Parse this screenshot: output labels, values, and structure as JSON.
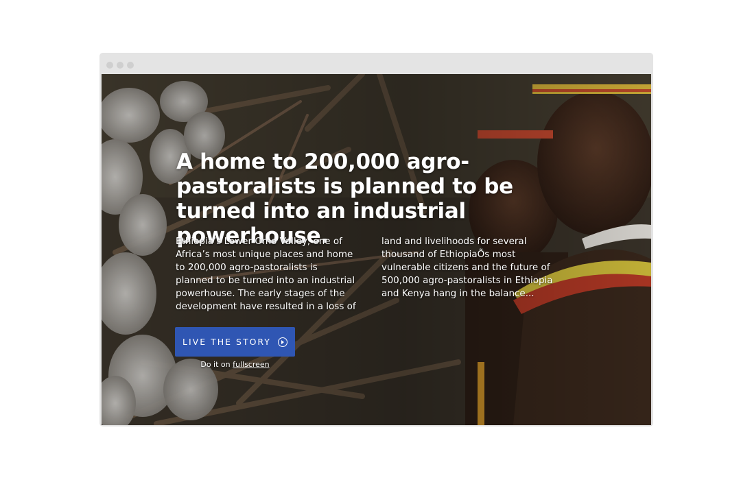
{
  "hero": {
    "headline": "A home to 200,000 agro-pastoralists is planned to be turned into an industrial powerhouse.",
    "body_left": "Ethiopia’s Lower Omo Valley, one of\nAfrica’s most unique places and home\nto 200,000 agro-pastoralists is\nplanned to be turned into an industrial\npowerhouse. The early stages of the\ndevelopment have resulted in a loss of",
    "body_right": "land and livelihoods for several\nthousand of EthiopiaÕs most\nvulnerable citizens and the future of\n500,000 agro-pastoralists in Ethiopia\nand Kenya hang in the balance...",
    "cta_label": "LIVE THE STORY",
    "cta_icon": "play-circle-icon",
    "fullscreen_prefix": "Do it on ",
    "fullscreen_link": "fullscreen"
  },
  "colors": {
    "cta_background": "#2f56b3",
    "frame": "#e4e4e4",
    "window_dot": "#cfcfcf"
  }
}
